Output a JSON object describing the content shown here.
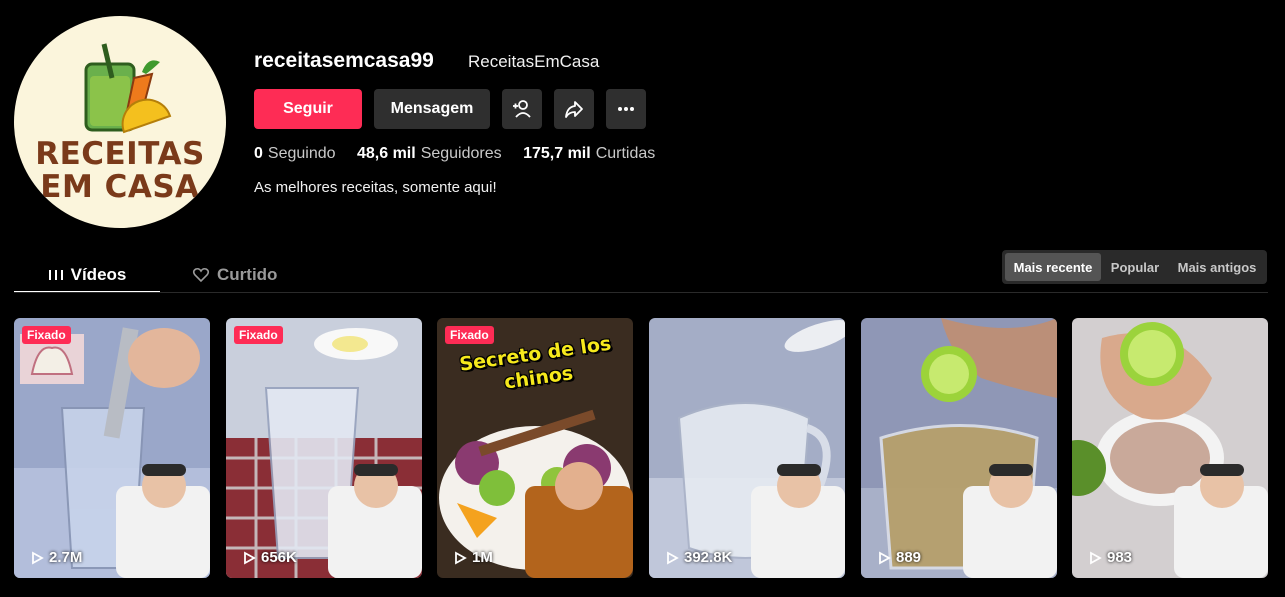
{
  "profile": {
    "username": "receitasemcasa99",
    "nickname": "ReceitasEmCasa",
    "logo_line1": "RECEITAS",
    "logo_line2": "EM CASA",
    "bio": "As melhores receitas, somente aqui!"
  },
  "actions": {
    "follow": "Seguir",
    "message": "Mensagem",
    "add_friend_icon": "add-person-icon",
    "share_icon": "share-arrow-icon",
    "more_icon": "more-dots-icon"
  },
  "stats": [
    {
      "value": "0",
      "label": "Seguindo"
    },
    {
      "value": "48,6 mil",
      "label": "Seguidores"
    },
    {
      "value": "175,7 mil",
      "label": "Curtidas"
    }
  ],
  "tabs": [
    {
      "label": "Vídeos",
      "active": true,
      "icon": "grid-icon"
    },
    {
      "label": "Curtido",
      "active": false,
      "icon": "liked-heart-icon"
    }
  ],
  "sort": [
    {
      "label": "Mais recente",
      "active": true
    },
    {
      "label": "Popular",
      "active": false
    },
    {
      "label": "Mais antigos",
      "active": false
    }
  ],
  "videos": [
    {
      "pinned": "Fixado",
      "views": "2.7M"
    },
    {
      "pinned": "Fixado",
      "views": "656K"
    },
    {
      "pinned": "Fixado",
      "views": "1M",
      "overlay_text": "Secreto de los chinos"
    },
    {
      "pinned": "",
      "views": "392.8K"
    },
    {
      "pinned": "",
      "views": "889"
    },
    {
      "pinned": "",
      "views": "983"
    }
  ],
  "colors": {
    "accent": "#fe2c55",
    "background": "#000000",
    "button": "#2f2f2f",
    "logo_text": "#7a3a1a"
  }
}
